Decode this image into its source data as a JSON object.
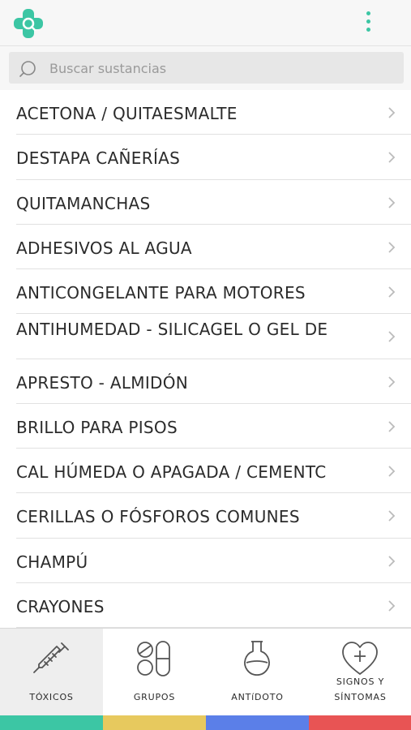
{
  "header": {
    "logo_icon": "medical-cross-logo-icon",
    "menu_icon": "more-vertical-icon",
    "accent_color": "#3cc6a4"
  },
  "search": {
    "placeholder": "Buscar sustancias",
    "value": "",
    "icon": "search-icon"
  },
  "substances": [
    {
      "label": "ACETONA / QUITAESMALTE"
    },
    {
      "label": "DESTAPA CAÑERÍAS"
    },
    {
      "label": "QUITAMANCHAS"
    },
    {
      "label": "ADHESIVOS AL AGUA"
    },
    {
      "label": "ANTICONGELANTE PARA MOTORES"
    },
    {
      "label": "ANTIHUMEDAD - SILICAGEL O GEL DE"
    },
    {
      "label": "APRESTO - ALMIDÓN"
    },
    {
      "label": "BRILLO PARA PISOS"
    },
    {
      "label": "CAL HÚMEDA O APAGADA / CEMENTC"
    },
    {
      "label": "CERILLAS O FÓSFOROS COMUNES"
    },
    {
      "label": "CHAMPÚ"
    },
    {
      "label": "CRAYONES"
    }
  ],
  "tabs": [
    {
      "label": "TÓXICOS",
      "icon": "syringe-icon",
      "color": "#3cc6a4",
      "active": true
    },
    {
      "label": "GRUPOS",
      "icon": "pills-icon",
      "color": "#e7c95e",
      "active": false
    },
    {
      "label": "ANTÍDOTO",
      "label_display": "ANTíDOTO",
      "icon": "flask-icon",
      "color": "#5b7fe8",
      "active": false
    },
    {
      "label_line1": "SIGNOS Y",
      "label_line2": "SÍNTOMAS",
      "icon": "heart-plus-icon",
      "color": "#e85454",
      "active": false
    }
  ]
}
